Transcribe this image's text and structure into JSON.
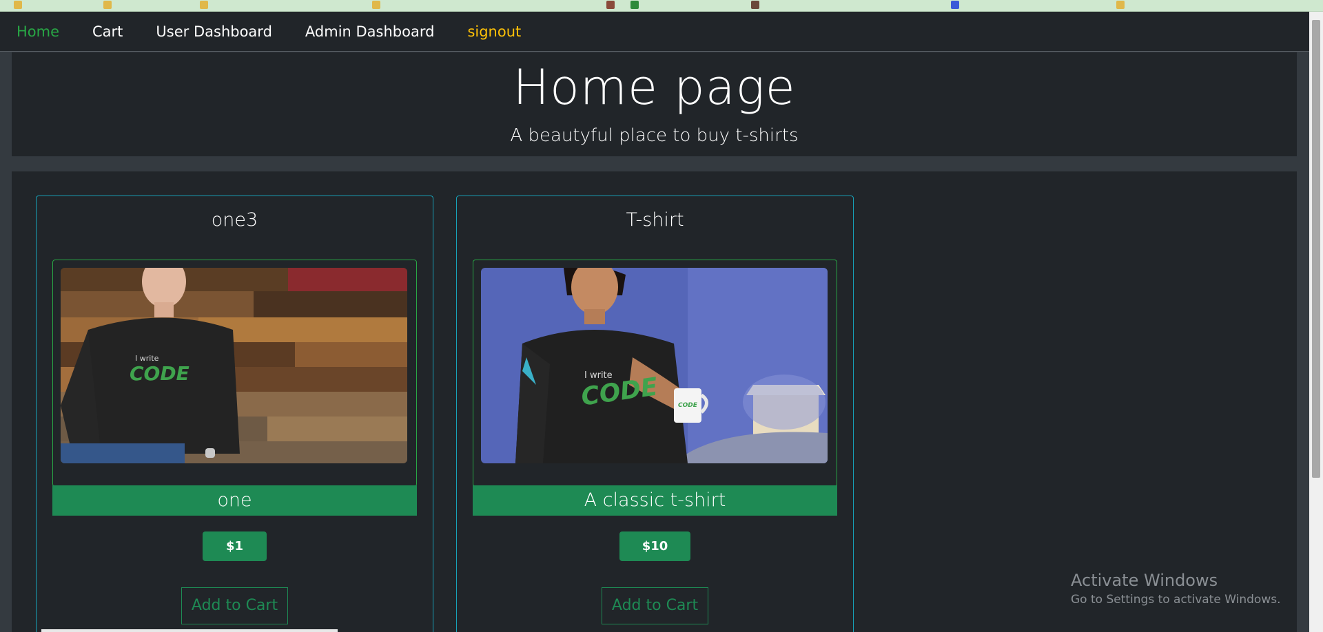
{
  "nav": {
    "home": "Home",
    "cart": "Cart",
    "user_dashboard": "User Dashboard",
    "admin_dashboard": "Admin Dashboard",
    "signout": "signout"
  },
  "jumbotron": {
    "title": "Home page",
    "subtitle": "A beautyful place to buy t-shirts"
  },
  "products": [
    {
      "name": "one3",
      "description": "one",
      "price": "$1",
      "add_to_cart": "Add to Cart"
    },
    {
      "name": "T-shirt",
      "description": "A classic t-shirt",
      "price": "$10",
      "add_to_cart": "Add to Cart"
    }
  ],
  "shirt_print": {
    "line1": "I write",
    "line2": "CODE"
  },
  "watermark": {
    "title": "Activate Windows",
    "subtitle": "Go to Settings to activate Windows."
  },
  "colors": {
    "nav_bg": "#212529",
    "active_link": "#28a745",
    "signout": "#ffc107",
    "card_border": "#17a2b8",
    "success": "#1e8a54"
  }
}
